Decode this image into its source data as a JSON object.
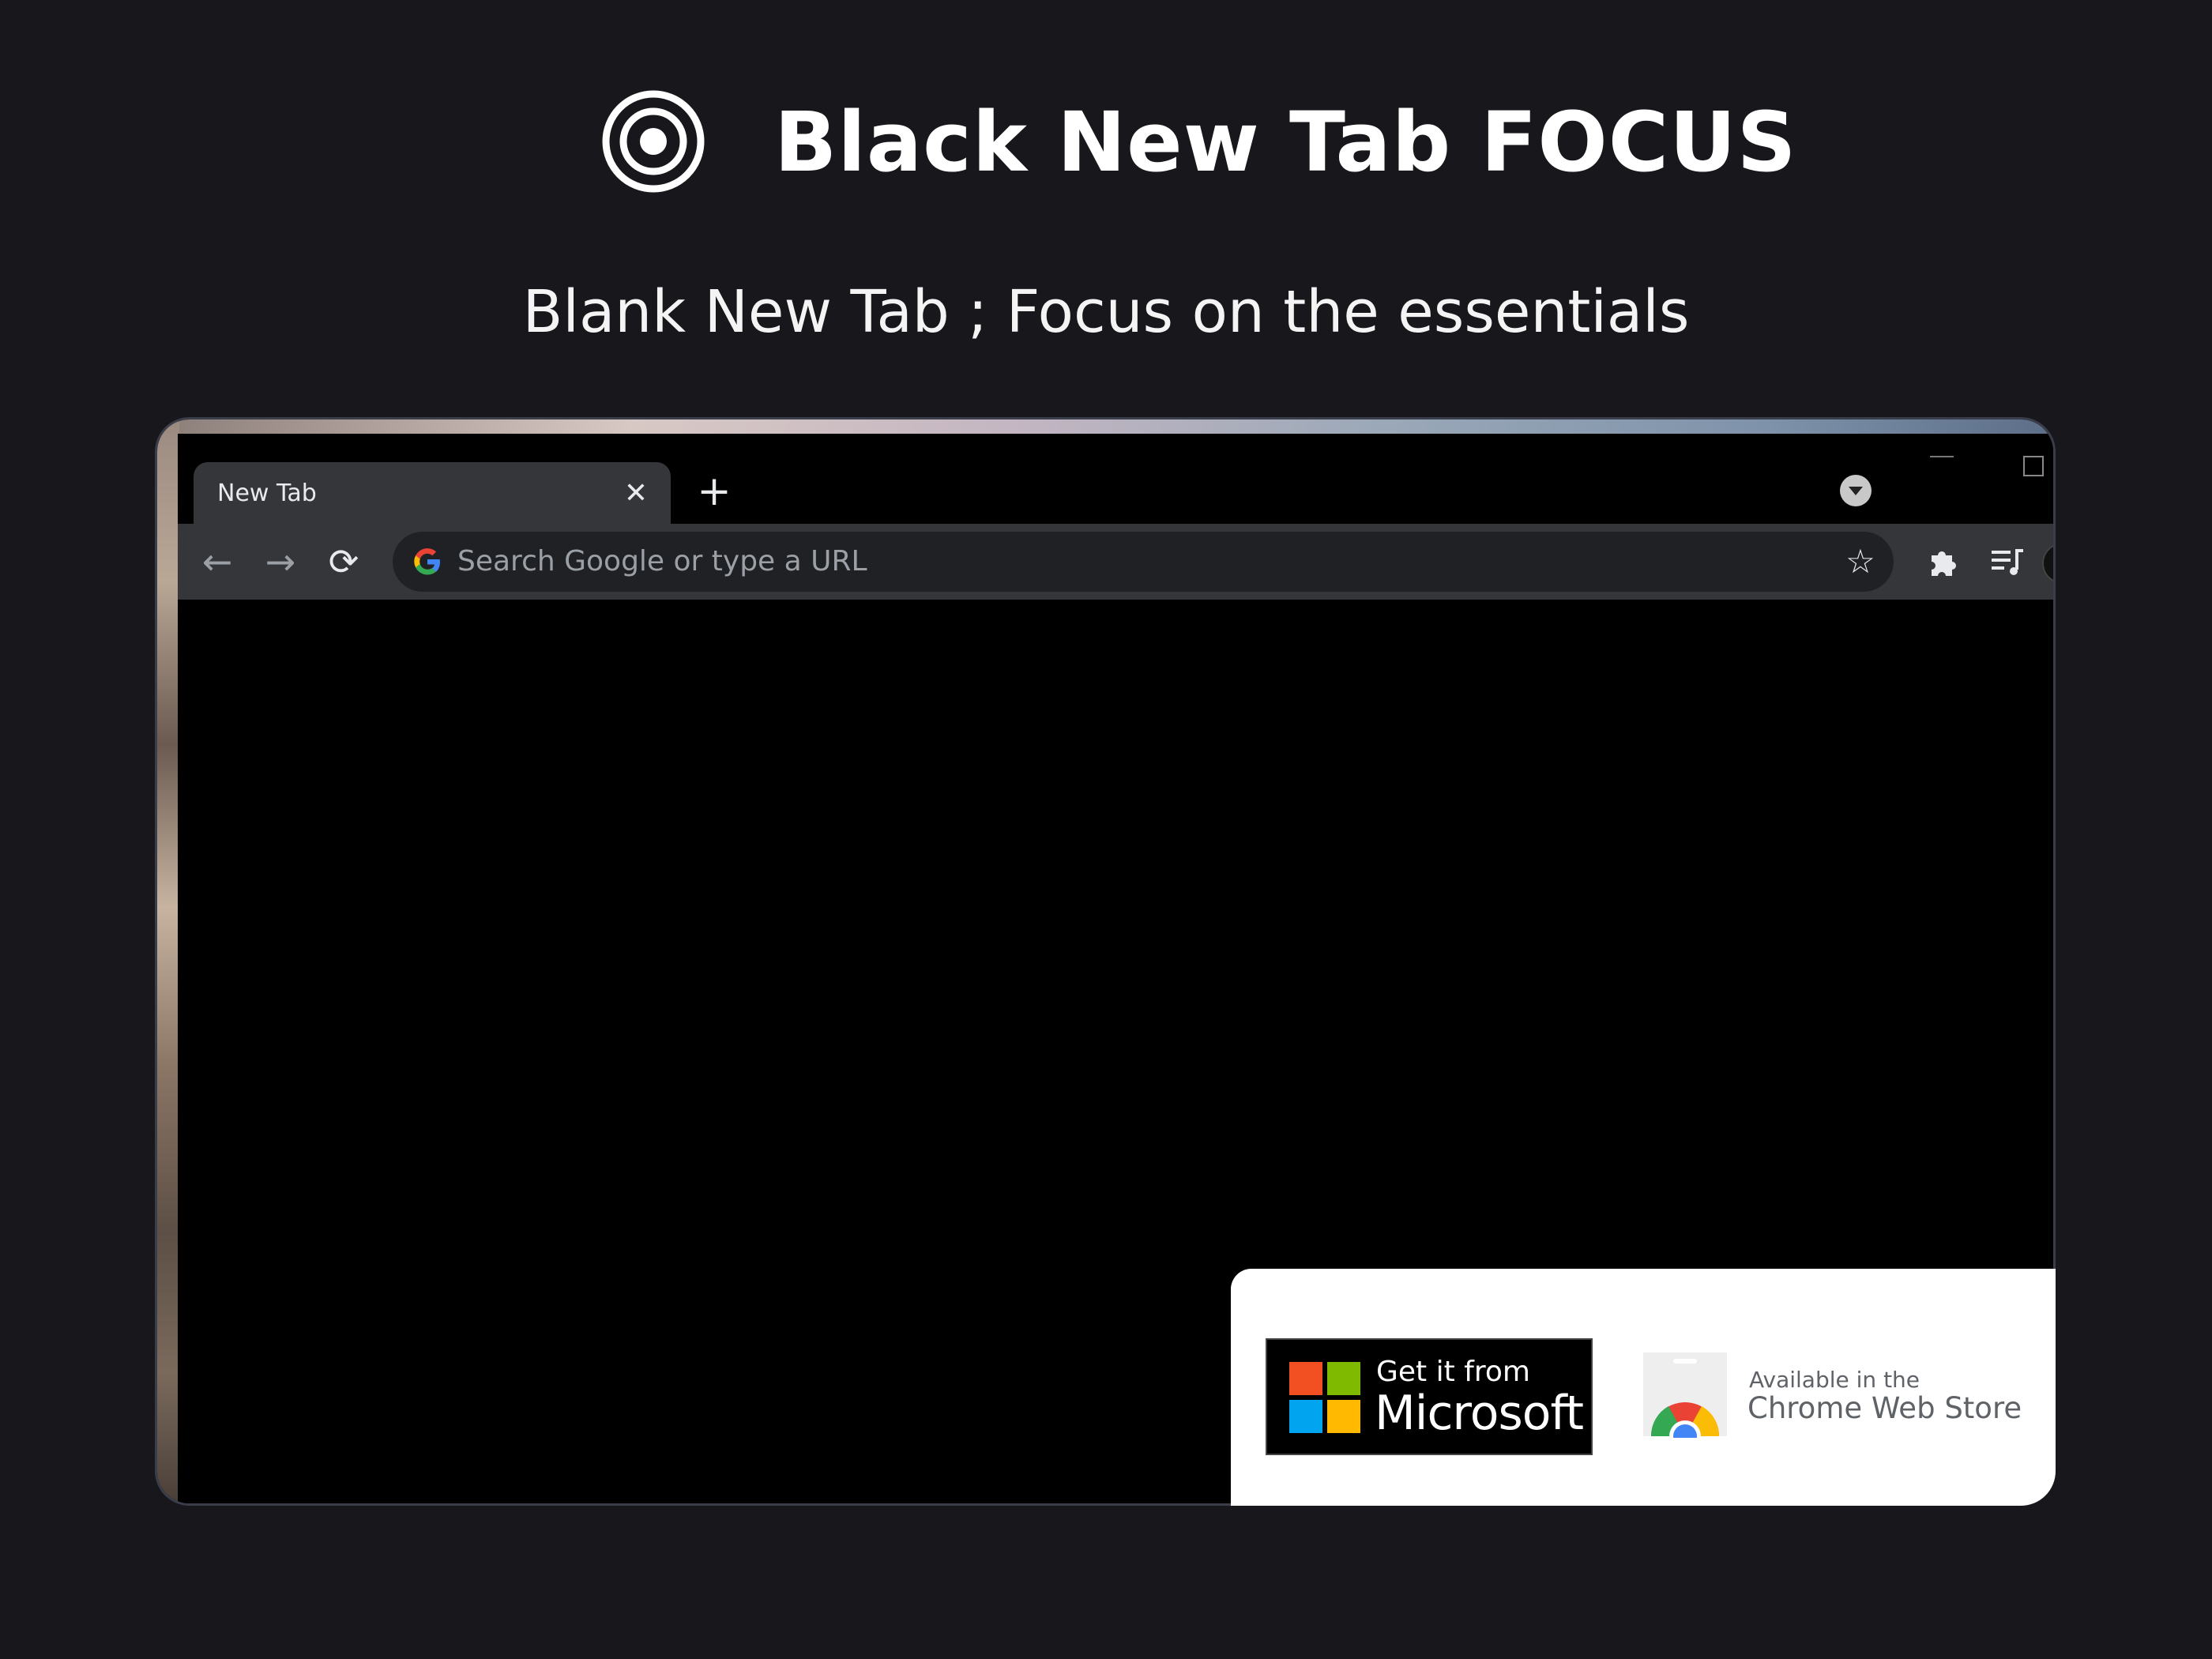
{
  "header": {
    "title": "Black New Tab FOCUS",
    "subtitle": "Blank New Tab ; Focus on the essentials"
  },
  "browser": {
    "tab": {
      "title": "New Tab",
      "close_glyph": "✕"
    },
    "new_tab_glyph": "+",
    "nav": {
      "back_glyph": "←",
      "forward_glyph": "→",
      "reload_glyph": "⟳"
    },
    "omnibox": {
      "placeholder": "Search Google or type a URL",
      "value": ""
    },
    "bookmark_glyph": "☆",
    "icons": [
      "target-icon",
      "close-icon",
      "plus-icon",
      "tab-search-icon",
      "minimize-icon",
      "maximize-icon",
      "back-arrow-icon",
      "forward-arrow-icon",
      "reload-icon",
      "google-icon",
      "star-icon",
      "puzzle-icon",
      "media-queue-icon",
      "avatar"
    ]
  },
  "badges": {
    "microsoft": {
      "top_text": "Get it from",
      "bottom_text": "Microsoft",
      "colors": [
        "#f25022",
        "#7fba00",
        "#00a4ef",
        "#ffb900"
      ]
    },
    "chrome": {
      "top_text": "Available in the",
      "bottom_text": "Chrome Web Store"
    }
  },
  "colors": {
    "background": "#17171c",
    "toolbar": "#35363a",
    "omnibox": "#202124",
    "page": "#000000"
  }
}
